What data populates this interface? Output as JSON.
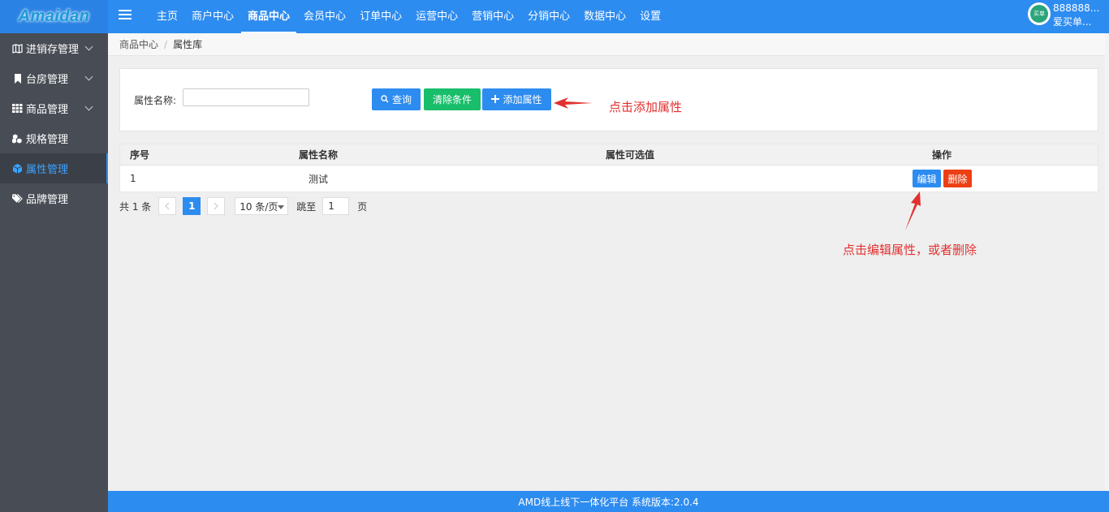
{
  "header": {
    "logo": "Amaidan",
    "nav": [
      "主页",
      "商户中心",
      "商品中心",
      "会员中心",
      "订单中心",
      "运营中心",
      "营销中心",
      "分销中心",
      "数据中心",
      "设置"
    ],
    "active_nav": "商品中心",
    "user": {
      "line1": "888888...",
      "line2": "爱买单...",
      "avatar_text": "买单"
    }
  },
  "sidebar": {
    "items": [
      {
        "label": "进销存管理",
        "icon": "map-icon",
        "expandable": true
      },
      {
        "label": "台房管理",
        "icon": "bookmark-icon",
        "expandable": true
      },
      {
        "label": "商品管理",
        "icon": "grid-icon",
        "expandable": true
      },
      {
        "label": "规格管理",
        "icon": "cubes-icon",
        "expandable": false
      },
      {
        "label": "属性管理",
        "icon": "cube-icon",
        "expandable": false,
        "active": true
      },
      {
        "label": "品牌管理",
        "icon": "tags-icon",
        "expandable": false
      }
    ]
  },
  "breadcrumb": {
    "parent": "商品中心",
    "separator": "/",
    "current": "属性库"
  },
  "filter": {
    "label": "属性名称:",
    "input_value": "",
    "buttons": {
      "search": "查询",
      "clear": "清除条件",
      "add": "添加属性"
    }
  },
  "annotations": {
    "add_hint": "点击添加属性",
    "edit_hint": "点击编辑属性，或者删除"
  },
  "table": {
    "columns": [
      "序号",
      "属性名称",
      "属性可选值",
      "操作"
    ],
    "rows": [
      {
        "index": "1",
        "name": "测试",
        "values": "",
        "edit": "编辑",
        "delete": "删除"
      }
    ]
  },
  "pagination": {
    "total": "共 1 条",
    "current_page": "1",
    "page_size": "10 条/页",
    "jump_label": "跳至",
    "jump_value": "1",
    "page_suffix": "页"
  },
  "footer": "AMD线上线下一体化平台 系统版本:2.0.4",
  "colors": {
    "primary": "#2d8cf0",
    "success": "#19be6b",
    "danger": "#ed3f14",
    "sidebar": "#484c55",
    "annotation": "#e23030"
  }
}
